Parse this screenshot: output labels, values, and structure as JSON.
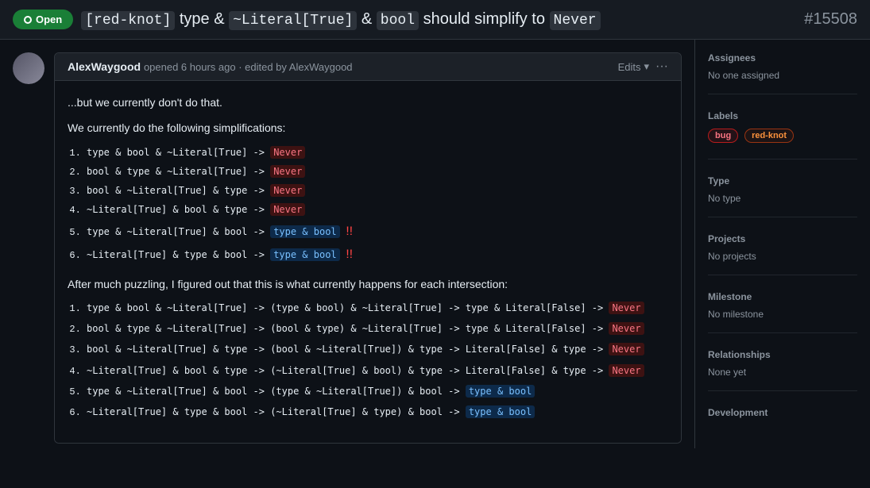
{
  "header": {
    "title_parts": [
      "[red-knot]",
      "type",
      "&",
      "~Literal[True]",
      "&",
      "bool",
      "should simplify to",
      "Never"
    ],
    "title_text": "[red-knot] type & ~Literal[True] & bool should simplify to Never",
    "issue_number": "#15508",
    "open_label": "Open"
  },
  "comment": {
    "author": "AlexWaygood",
    "meta": "opened 6 hours ago · edited by AlexWaygood",
    "edits_label": "Edits",
    "more_label": "···",
    "body_line1": "...but we currently don't do that.",
    "body_line2": "We currently do the following simplifications:",
    "body_line3": "After much puzzling, I figured out that this is what currently happens for each intersection:"
  },
  "simplifications": [
    "type & bool & ~Literal[True] -> Never",
    "bool & type & ~Literal[True] -> Never",
    "bool & ~Literal[True] & type -> Never",
    "~Literal[True] & bool & type -> Never",
    "type & ~Literal[True] & bool -> type & bool !!",
    "~Literal[True] & type & bool -> type & bool !!"
  ],
  "intersections": [
    "type & bool & ~Literal[True] -> (type & bool) & ~Literal[True] -> type & Literal[False] -> Never",
    "bool & type & ~Literal[True] -> (bool & type) & ~Literal[True] -> type & Literal[False] -> Never",
    "bool & ~Literal[True] & type -> (bool & ~Literal[True]) & type -> Literal[False] & type -> Never",
    "~Literal[True] & bool & type -> (~Literal[True] & bool) & type -> Literal[False] & type -> Never",
    "type & ~Literal[True] & bool -> (type & ~Literal[True]) & bool -> type & bool",
    "~Literal[True] & type & bool -> (~Literal[True] & type) & bool -> type & bool"
  ],
  "sidebar": {
    "assignees_title": "Assignees",
    "assignees_value": "No one assigned",
    "labels_title": "Labels",
    "labels": [
      {
        "name": "bug",
        "type": "bug"
      },
      {
        "name": "red-knot",
        "type": "red-knot"
      }
    ],
    "type_title": "Type",
    "type_value": "No type",
    "projects_title": "Projects",
    "projects_value": "No projects",
    "milestone_title": "Milestone",
    "milestone_value": "No milestone",
    "relationships_title": "Relationships",
    "relationships_value": "None yet",
    "development_title": "Development"
  }
}
